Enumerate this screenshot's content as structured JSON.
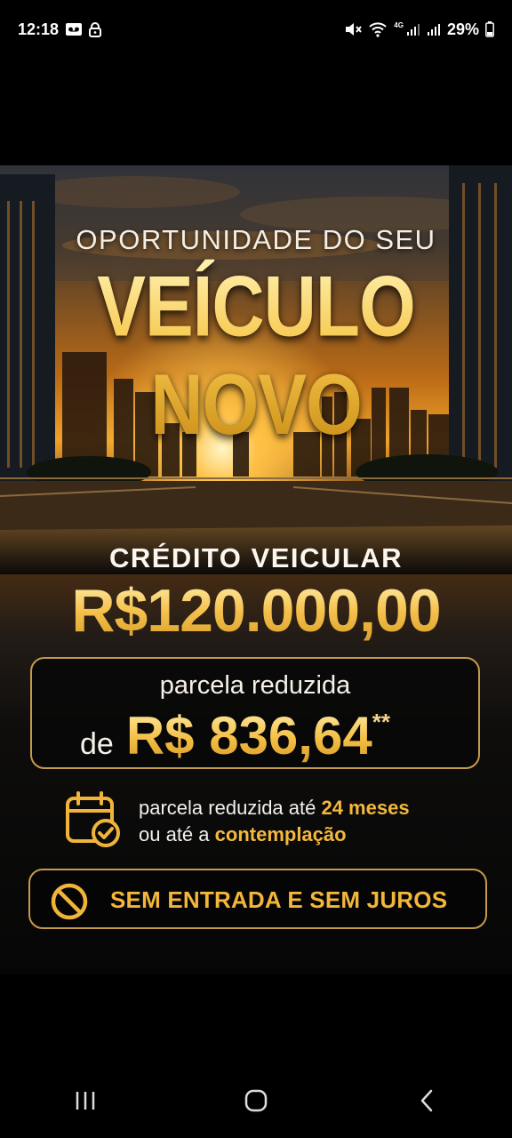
{
  "status_bar": {
    "time": "12:18",
    "network_tag": "4G",
    "battery": "29%",
    "icons": [
      "voicemail-icon",
      "lock-icon",
      "mute-icon",
      "wifi-icon",
      "signal-icon",
      "signal-icon",
      "battery-icon"
    ]
  },
  "ad": {
    "headline_top": "OPORTUNIDADE DO SEU",
    "headline_main": "VEÍCULO NOVO",
    "credit_label": "CRÉDITO VEICULAR",
    "credit_value": "R$120.000,00",
    "parcela_label": "parcela reduzida",
    "parcela_prefix": "de",
    "parcela_value": "R$ 836,64",
    "parcela_note": "**",
    "term_line1_text": "parcela reduzida até ",
    "term_line1_highlight": "24 meses",
    "term_line2_text": "ou até a ",
    "term_line2_highlight": "contemplação",
    "free_label": "SEM ENTRADA E SEM JUROS",
    "colors": {
      "gold": "#f3b83c",
      "border": "#c59a4b"
    }
  },
  "nav_bar": {
    "buttons": [
      "recent-apps-icon",
      "home-icon",
      "back-icon"
    ]
  }
}
